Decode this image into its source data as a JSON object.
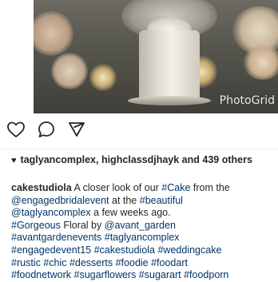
{
  "photo": {
    "watermark": "PhotoGrid"
  },
  "actions": {
    "icons": [
      "heart-icon",
      "comment-icon",
      "share-icon"
    ]
  },
  "likes": {
    "heart": "♥",
    "text": "taglyancomplex, highclassdjhayk and 439 others"
  },
  "caption": {
    "username": "cakestudiola",
    "lines": [
      {
        "pre": " A closer look of our ",
        "tag": "#Cake",
        "post": " from the"
      },
      {
        "tag": "@engagedbridalevent",
        "mid": " at the ",
        "tag2": "#beautiful"
      },
      {
        "tag": "@taglyancomplex",
        "post": " a few weeks ago."
      },
      {
        "tag": "#Gorgeous",
        "mid": " Floral by ",
        "tag2": "@avant_garden"
      },
      {
        "text": "#avantgardenevents #taglyancomplex"
      },
      {
        "text": "#engagedevent15 #cakestudiola #weddingcake"
      },
      {
        "text": "#rustic #chic #desserts #foodie #foodart"
      },
      {
        "text": "#foodnetwork #sugarflowers #sugarart #foodporn"
      }
    ]
  },
  "colors": {
    "hashtag": "#003569",
    "text": "#262626",
    "separator": "#efefef"
  }
}
